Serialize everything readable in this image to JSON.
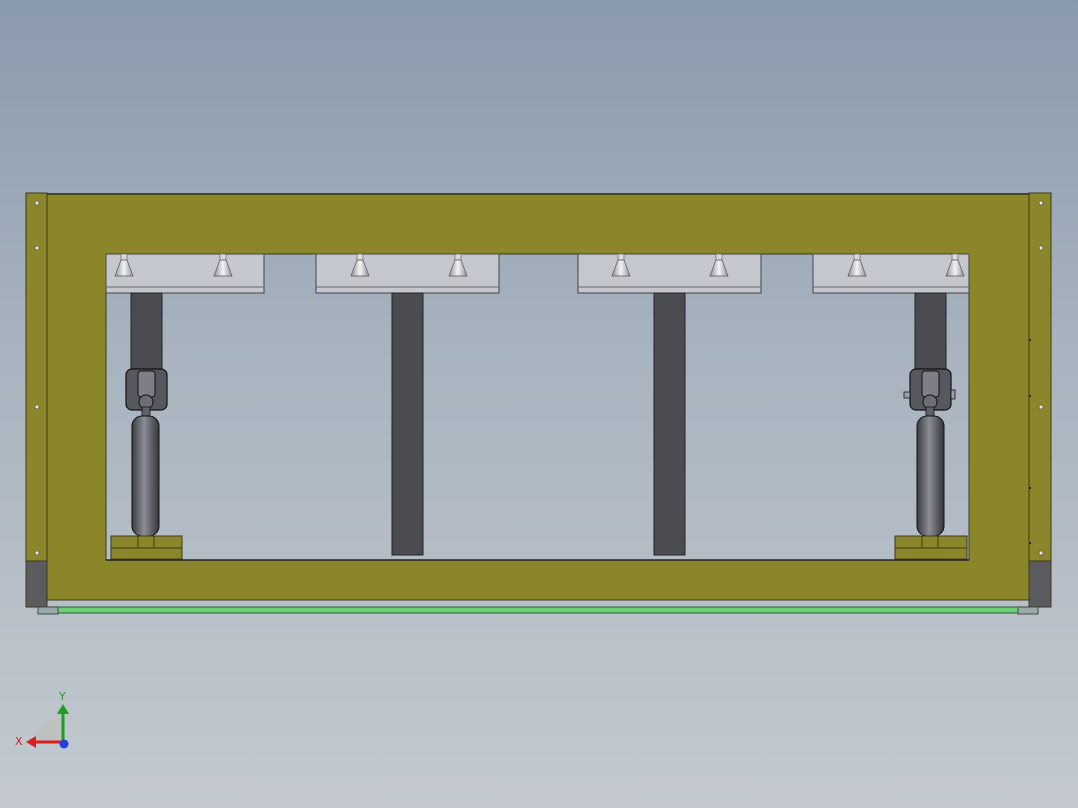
{
  "viewport": {
    "view": "Front",
    "background": [
      "#8a9aad",
      "#c3c9cf"
    ]
  },
  "model": {
    "frame_color": "#8c862b",
    "frame_edge_color": "#3a3a1a",
    "steel_color": "#c4c7ce",
    "post_color": "#4a4c52",
    "rail_color": "#6fd07a",
    "cylinder_color": "#55585f"
  },
  "triad": {
    "x_label": "X",
    "y_label": "Y",
    "x_color": "#d92020",
    "y_color": "#1ea01e",
    "z_color": "#2040e0"
  }
}
